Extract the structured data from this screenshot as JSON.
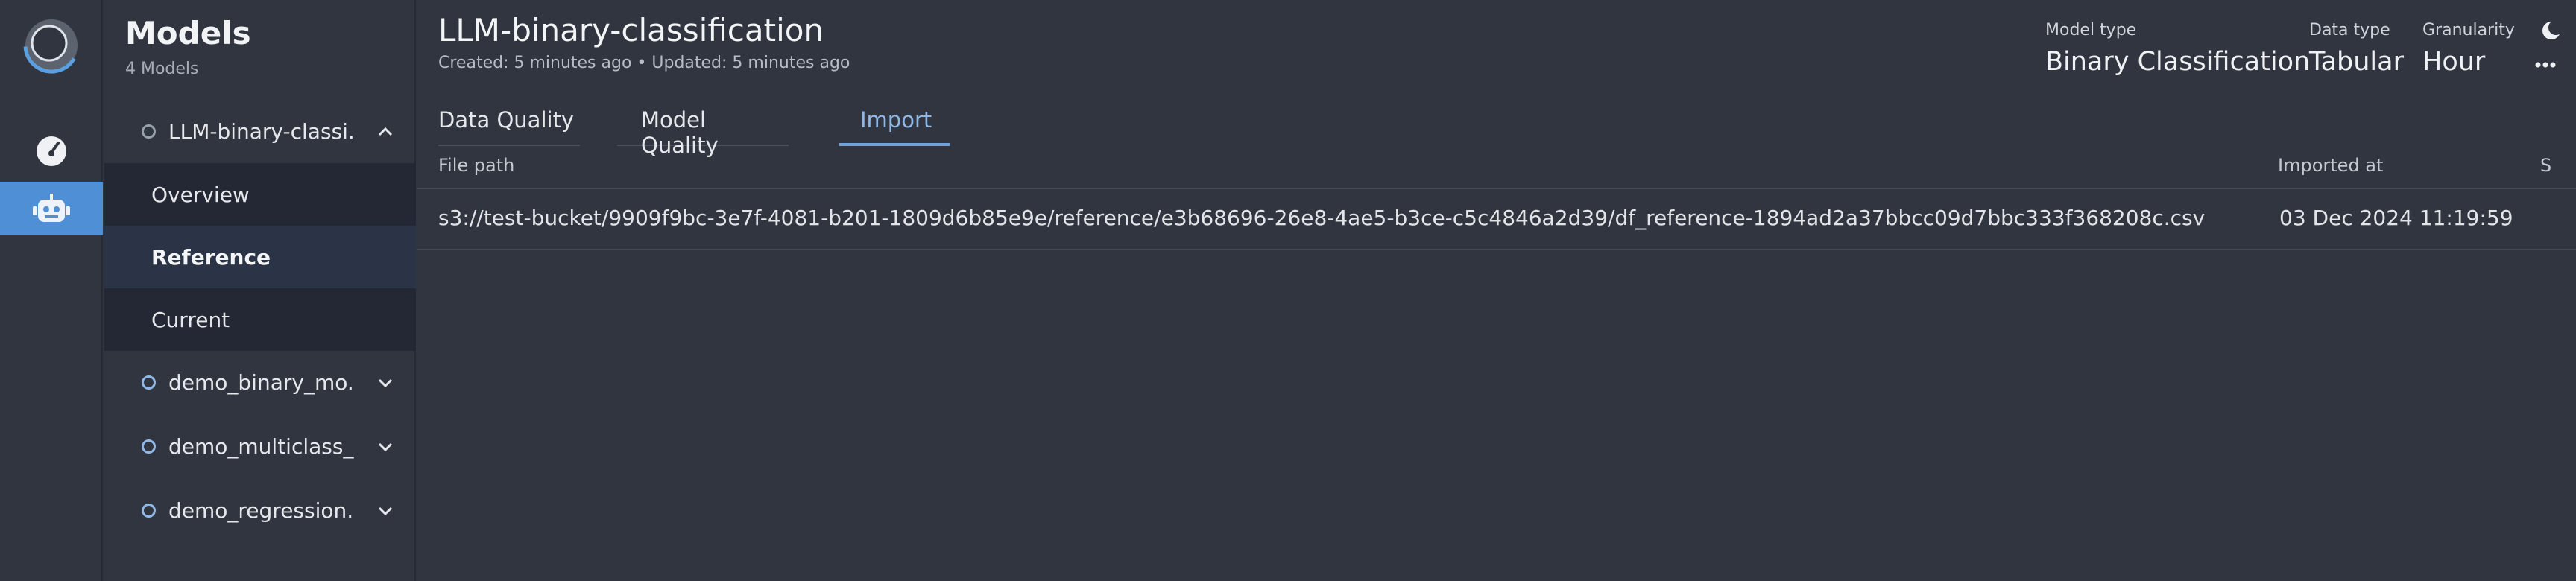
{
  "rail": {
    "icons": [
      "logo-icon",
      "speedometer-icon",
      "robot-icon"
    ]
  },
  "sidebar": {
    "title": "Models",
    "count": "4 Models",
    "items": [
      {
        "label": "LLM-binary-classi...",
        "expanded": true
      },
      {
        "label": "demo_binary_mo...",
        "expanded": false
      },
      {
        "label": "demo_multiclass_...",
        "expanded": false
      },
      {
        "label": "demo_regression...",
        "expanded": false
      }
    ],
    "subitems": [
      "Overview",
      "Reference",
      "Current"
    ],
    "active_subitem": "Reference"
  },
  "header": {
    "title": "LLM-binary-classification",
    "meta": "Created: 5 minutes ago • Updated: 5 minutes ago",
    "model_type_label": "Model type",
    "model_type_value": "Binary Classification",
    "data_type_label": "Data type",
    "data_type_value": "Tabular",
    "granularity_label": "Granularity",
    "granularity_value": "Hour"
  },
  "tabs": [
    "Data Quality",
    "Model Quality",
    "Import"
  ],
  "active_tab": "Import",
  "table": {
    "columns": [
      "File path",
      "Imported at",
      "S"
    ],
    "rows": [
      {
        "file_path": "s3://test-bucket/9909f9bc-3e7f-4081-b201-1809d6b85e9e/reference/e3b68696-26e8-4ae5-b3ce-c5c4846a2d39/df_reference-1894ad2a37bbcc09d7bbc333f368208c.csv",
        "imported_at": "03 Dec 2024 11:19:59"
      }
    ]
  },
  "colors": {
    "accent": "#6fa3dc",
    "background": "#303540",
    "sidebar_sub_bg": "#232834",
    "active_sub_bg": "#2b3446"
  }
}
